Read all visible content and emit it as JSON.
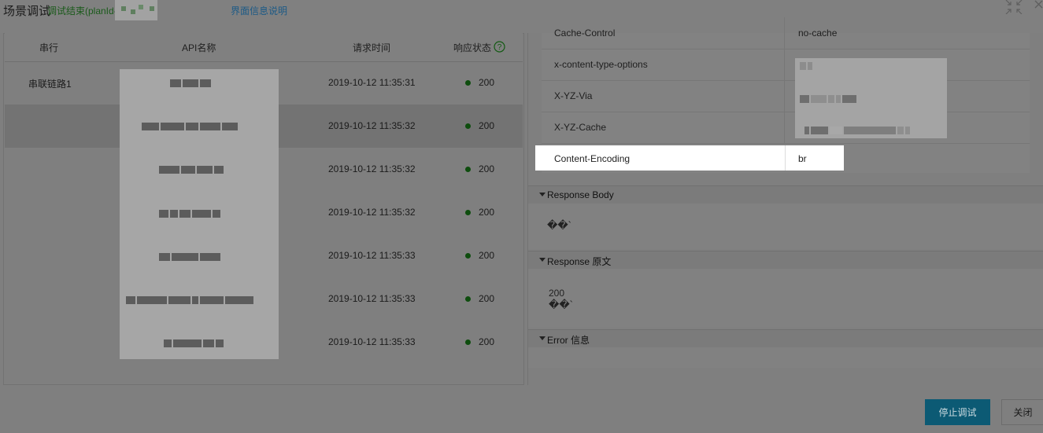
{
  "header": {
    "title": "场景调试",
    "status": "调试结束(planId-",
    "help_link": "界面信息说明"
  },
  "table": {
    "columns": {
      "serial": "串行",
      "api_name": "API名称",
      "request_time": "请求时间",
      "response_status": "响应状态"
    },
    "rows": [
      {
        "serial": "串联链路1",
        "time": "2019-10-12 11:35:31",
        "code": "200"
      },
      {
        "serial": "",
        "time": "2019-10-12 11:35:32",
        "code": "200"
      },
      {
        "serial": "",
        "time": "2019-10-12 11:35:32",
        "code": "200"
      },
      {
        "serial": "",
        "time": "2019-10-12 11:35:32",
        "code": "200"
      },
      {
        "serial": "",
        "time": "2019-10-12 11:35:33",
        "code": "200"
      },
      {
        "serial": "",
        "time": "2019-10-12 11:35:33",
        "code": "200"
      },
      {
        "serial": "",
        "time": "2019-10-12 11:35:33",
        "code": "200"
      }
    ]
  },
  "response_headers": [
    {
      "key": "Cache-Control",
      "value": "no-cache"
    },
    {
      "key": "x-content-type-options",
      "value": ""
    },
    {
      "key": "X-YZ-Via",
      "value": ""
    },
    {
      "key": "X-YZ-Cache",
      "value": ""
    }
  ],
  "highlighted_header": {
    "key": "Content-Encoding",
    "value": "br"
  },
  "sections": {
    "response_body": {
      "label": "Response Body",
      "content": "��`"
    },
    "response_raw": {
      "label": "Response 原文",
      "status": "200",
      "content": "��`"
    },
    "error": {
      "label": "Error 信息"
    }
  },
  "footer": {
    "stop_label": "停止调试",
    "close_label": "关闭"
  },
  "colors": {
    "primary": "#1aa3c8",
    "success": "#1c9a1c"
  }
}
